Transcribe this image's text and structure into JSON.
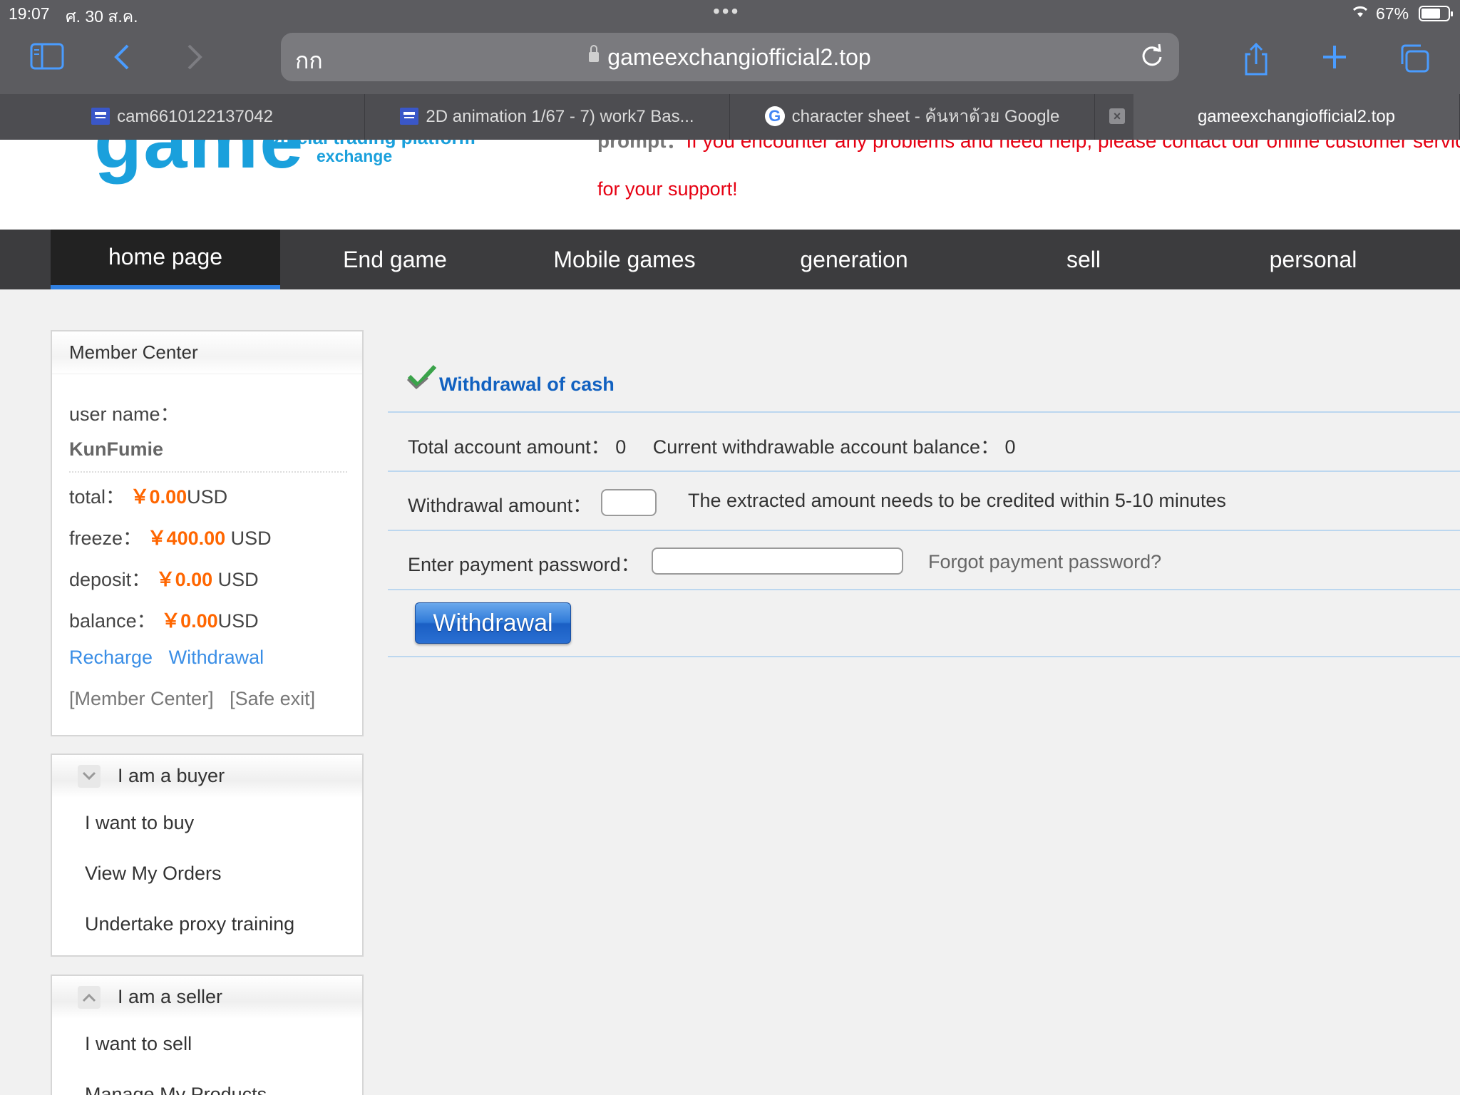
{
  "status_bar": {
    "time": "19:07",
    "date": "ศ. 30 ส.ค.",
    "dots": "•••",
    "battery": "67%"
  },
  "browser": {
    "aa_label": "กก",
    "url": "gameexchangiofficial2.top",
    "tabs": [
      {
        "label": "cam6610122137042"
      },
      {
        "label": "2D animation 1/67 - 7) work7 Bas..."
      },
      {
        "label": "character sheet - ค้นหาด้วย Google"
      },
      {
        "label": "gameexchangiofficial2.top"
      }
    ],
    "tab_close": "×"
  },
  "header": {
    "logo_main": "game",
    "logo_sub1": "Official trading platform",
    "logo_sub2": "exchange",
    "prompt_label": "prompt：",
    "prompt_text": "If you encounter any problems and need help, please contact our online customer service",
    "prompt_line2": "for your support!"
  },
  "nav": {
    "items": [
      {
        "label": "home page"
      },
      {
        "label": "End game"
      },
      {
        "label": "Mobile games"
      },
      {
        "label": "generation"
      },
      {
        "label": "sell"
      },
      {
        "label": "personal"
      }
    ]
  },
  "member_center": {
    "title": "Member Center",
    "user_name_label": "user name：",
    "user_name": "KunFumie",
    "total_label": "total：",
    "total_value": "￥0.00",
    "total_unit": "USD",
    "freeze_label": "freeze：",
    "freeze_value": "￥400.00",
    "freeze_unit": " USD",
    "deposit_label": "deposit：",
    "deposit_value": "￥0.00",
    "deposit_unit": " USD",
    "balance_label": "balance：",
    "balance_value": "￥0.00",
    "balance_unit": "USD",
    "recharge_link": "Recharge",
    "withdrawal_link": "Withdrawal",
    "member_center_link": "[Member Center]",
    "safe_exit_link": "[Safe exit]"
  },
  "buyer": {
    "title": "I am a buyer",
    "items": [
      {
        "label": "I want to buy"
      },
      {
        "label": "View My Orders"
      },
      {
        "label": "Undertake proxy training"
      }
    ]
  },
  "seller": {
    "title": "I am a seller",
    "items": [
      {
        "label": "I want to sell"
      },
      {
        "label": "Manage My Products"
      }
    ]
  },
  "withdrawal": {
    "title": "Withdrawal of cash",
    "total_label": "Total account amount：",
    "total_value": "0",
    "withdrawable_label": "Current withdrawable account balance：",
    "withdrawable_value": "0",
    "amount_label": "Withdrawal amount：",
    "amount_value": "",
    "amount_note": "The extracted amount needs to be credited within 5-10 minutes",
    "password_label": "Enter payment password：",
    "password_value": "",
    "forgot_link": "Forgot payment password?",
    "submit_label": "Withdrawal"
  },
  "colors": {
    "accent_blue": "#1161c0",
    "amount_orange": "#ff6600",
    "prompt_red": "#e60012",
    "nav_bg": "#3c3c3e",
    "nav_active_underline": "#2f7fe0",
    "logo_blue": "#1aa0dc"
  },
  "icons": [
    "sidebar-icon",
    "back-icon",
    "forward-icon",
    "lock-icon",
    "reload-icon",
    "share-icon",
    "plus-icon",
    "tabs-icon",
    "check-icon",
    "chevron-down-icon",
    "chevron-up-icon"
  ]
}
